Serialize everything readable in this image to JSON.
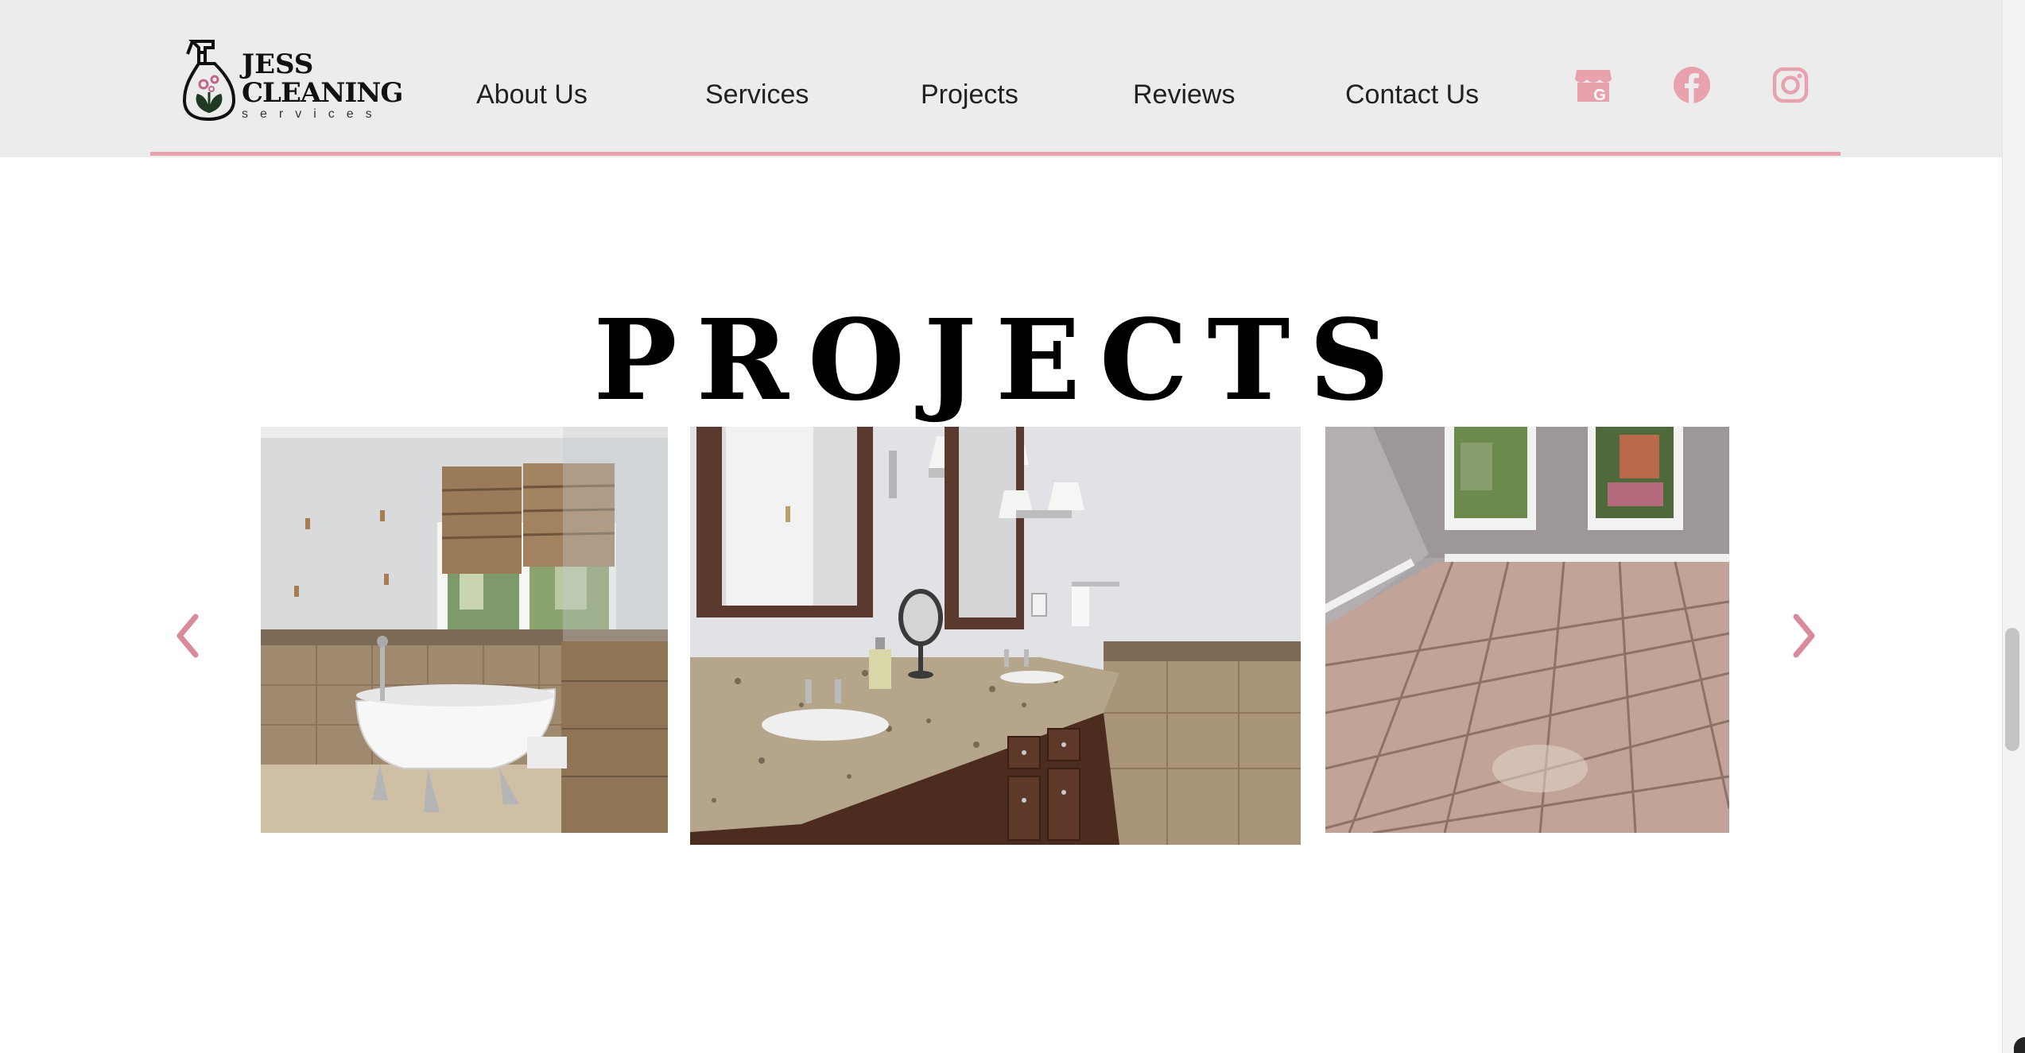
{
  "brand": {
    "name_line1": "JESS",
    "name_line2": "CLEANING",
    "name_line3": "services"
  },
  "nav": {
    "items": [
      {
        "label": "About Us"
      },
      {
        "label": "Services"
      },
      {
        "label": "Projects"
      },
      {
        "label": "Reviews"
      },
      {
        "label": "Contact Us"
      }
    ]
  },
  "social": {
    "icons": [
      "google-business-icon",
      "facebook-icon",
      "instagram-icon"
    ]
  },
  "section": {
    "title": "PROJECTS"
  },
  "carousel": {
    "slides": [
      {
        "subject": "bathroom-clawfoot-tub"
      },
      {
        "subject": "bathroom-double-vanity"
      },
      {
        "subject": "tiled-room-floor"
      }
    ]
  },
  "colors": {
    "accent_pink": "#e8a2ae",
    "header_bg": "#ececec",
    "text_dark": "#222222",
    "logo_dark": "#1f3a22"
  }
}
